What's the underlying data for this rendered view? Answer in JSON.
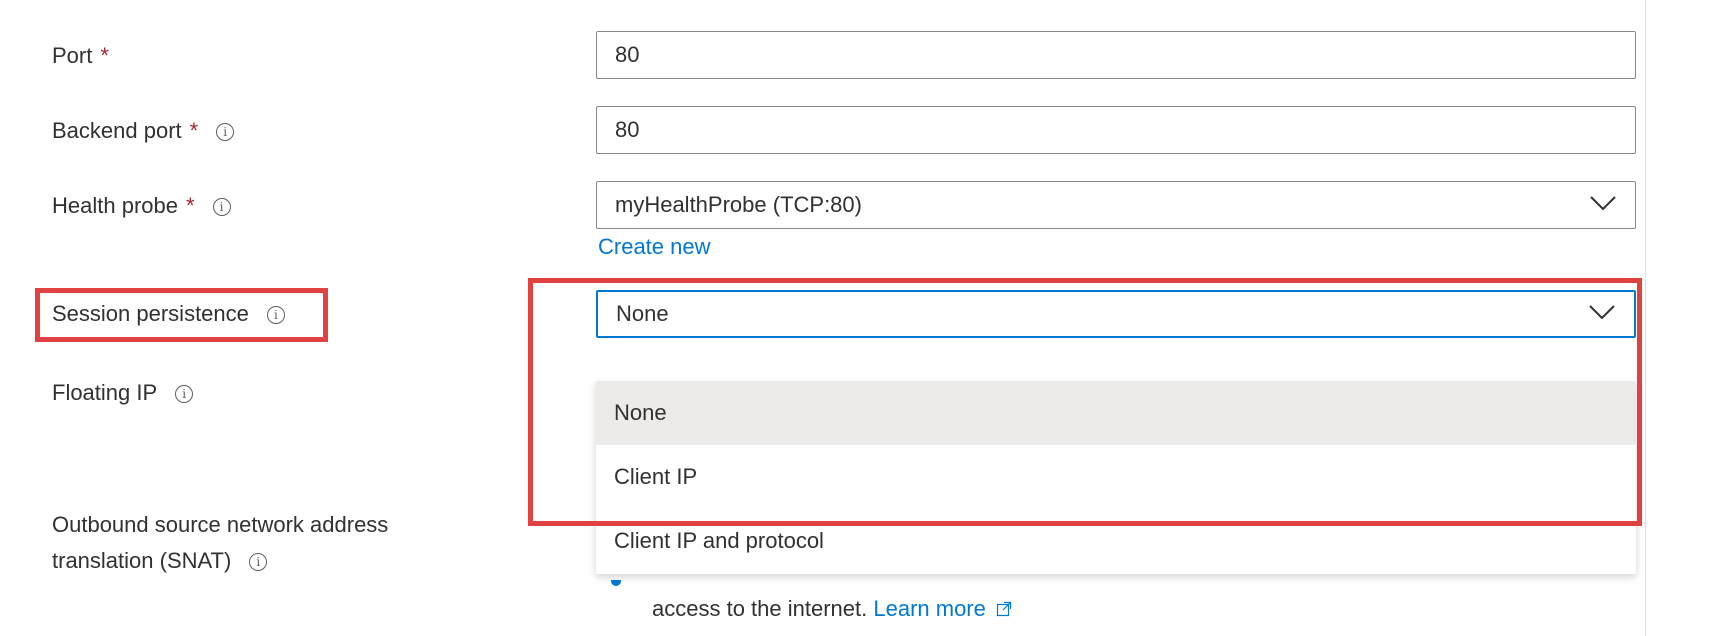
{
  "form": {
    "port": {
      "label": "Port",
      "required_mark": "*",
      "value": "80"
    },
    "backend_port": {
      "label": "Backend port",
      "required_mark": "*",
      "value": "80"
    },
    "health_probe": {
      "label": "Health probe",
      "required_mark": "*",
      "value": "myHealthProbe (TCP:80)",
      "create_new": "Create new"
    },
    "session_persistence": {
      "label": "Session persistence",
      "value": "None",
      "options": [
        "None",
        "Client IP",
        "Client IP and protocol"
      ]
    },
    "floating_ip": {
      "label": "Floating IP"
    },
    "snat": {
      "label_line1": "Outbound source network address",
      "label_line2": "translation (SNAT)",
      "help_text": "access to the internet.",
      "learn_more": "Learn more"
    }
  },
  "icons": {
    "info": "info-icon",
    "chevron": "chevron-down-icon",
    "external": "external-link-icon"
  },
  "colors": {
    "accent": "#0078d4",
    "highlight": "#e04141",
    "required": "#a4262c"
  }
}
